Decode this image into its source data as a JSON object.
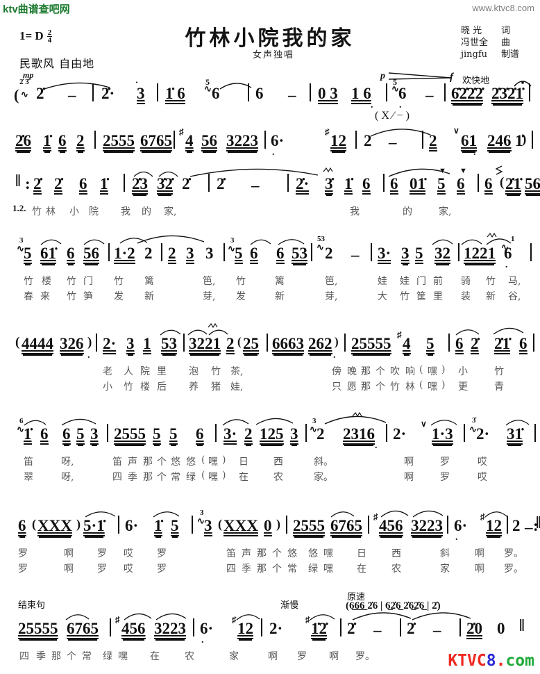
{
  "page": {
    "site_logo": "ktv曲谱查吧网",
    "site_url": "www.ktvc8.com",
    "footer_logo": {
      "part1": "KTV",
      "part2": "C",
      "part3": "8",
      "part4": ".",
      "part5": "com"
    }
  },
  "header": {
    "title": "竹林小院我的家",
    "subtitle": "女声独唱",
    "key": "1= D",
    "meter_num": "2",
    "meter_den": "4",
    "style": "民歌风 自由地",
    "dynamic_mp": "mp",
    "credits": [
      {
        "name": "晓  光",
        "role": "词"
      },
      {
        "name": "冯世全",
        "role": "曲"
      },
      {
        "name": "jingfu",
        "role": "制谱"
      }
    ],
    "hairpin": {
      "from": "p",
      "to": "f",
      "text": "欢快地"
    }
  },
  "annotations": {
    "ending_phrase": "结束句",
    "rit": "渐慢",
    "a_tempo": "原速",
    "ossia_intro": "( X  ⁄  − )",
    "repeat_marks": [
      "1.2."
    ]
  },
  "score": {
    "lines": [
      {
        "id": "line-1",
        "notes": "( 2̇ 3̇ | 2̇  −  | 2̇·  3̣ | 1̇ 6  5̰6 | 6  −  | 0 3 1 6̣ | 5̰6̣  −  | 6̲2̇2̇2̇ 2̇3̇2̇1̇ |",
        "lyrics": ""
      },
      {
        "id": "line-2",
        "notes": "2̇6 1̇ 6 2 | 2555 6765 | ♯4 56 3223 | 6̣·  ♯12 | 2  −  | 2  ᵛ61̣ 2461̇ ) |",
        "lyrics": ""
      },
      {
        "id": "line-3",
        "notes": "‖: 2̇ 2̇ 6 1̇ | 2̇3̇3̇2̇ 2̇ | 2̇  −  | 2̇· 3̇ 1̇ 6 | 6 01̇ 5 6 | 6 (2̇1̇ 566) |",
        "lyrics_1": "1.2.竹林 小院 我 的 家,             我    的  家,"
      },
      {
        "id": "line-4",
        "notes": "3̰5 61̇ 6 56 | 1·22 | 23 3 | 3̰56 653 | 5̰3̰2 − | 3· 35 32 | 1221̰6̣ |",
        "lyrics_1": "竹楼 竹门 竹 篱   笆, 竹 篱   笆,   娃 娃门前 骑 竹 马,",
        "lyrics_2": "春来 竹笋 发 新   芽, 发 新   芽,   大 竹筐里 装 新 谷,"
      },
      {
        "id": "line-5",
        "notes": "(4444 326) | 2· 3 1 53 | 3221 2(25 | 6663 262) | 25555♯4 5 | 62 2̇1̇6 |",
        "lyrics_1": "老 人院里 泡 竹 茶,   傍晚那个吹响(嘿) 小   竹",
        "lyrics_2": "小 竹楼后 养 猪 娃,   只愿那个竹林(嘿) 更   青"
      },
      {
        "id": "line-6",
        "notes": "6̰1̇ 6 653 | 2555 5 5 6 | 3·2 1253 | 3̰2 2316 | 2· ᵛ1·3 | 3̰2· 31̇ |",
        "lyrics_1": "笛   呀,   笛声那个悠悠(嘿) 日   西     斜。        啊   罗   哎",
        "lyrics_2": "翠   呀,   四季那个常绿(嘿) 在   农     家。        啊   罗   哎"
      },
      {
        "id": "line-7",
        "notes": "6(XXX)5·1̇ | 6· 1̇5 | 3̰3(XXX0) | 25556765 | ♯456 3223 | 6̣· ♯12 | 2 − :‖",
        "lyrics_1": "罗   啊 罗 哎 罗       笛声那个悠 悠嘿 日  西    斜 啊 罗。",
        "lyrics_2": "罗   啊 罗 哎 罗       四季那个常 绿嘿 在  农    家 啊 罗。"
      },
      {
        "id": "line-8",
        "notes": "25555 6765 | ♯456 3223 | 6̣· ♯12 | 2· ♯1̲2̲ | 2̇ − | 2̇ − | 2̇0 0 ‖",
        "ossia": "(6̲6̲6̲ 2̇6 | 6̲2̇6̲ 2̇6̲2̇6̲ | 2̇)",
        "lyrics_1": "四季那个常 绿嘿 在  农    家  啊  罗  啊 罗。"
      }
    ]
  }
}
